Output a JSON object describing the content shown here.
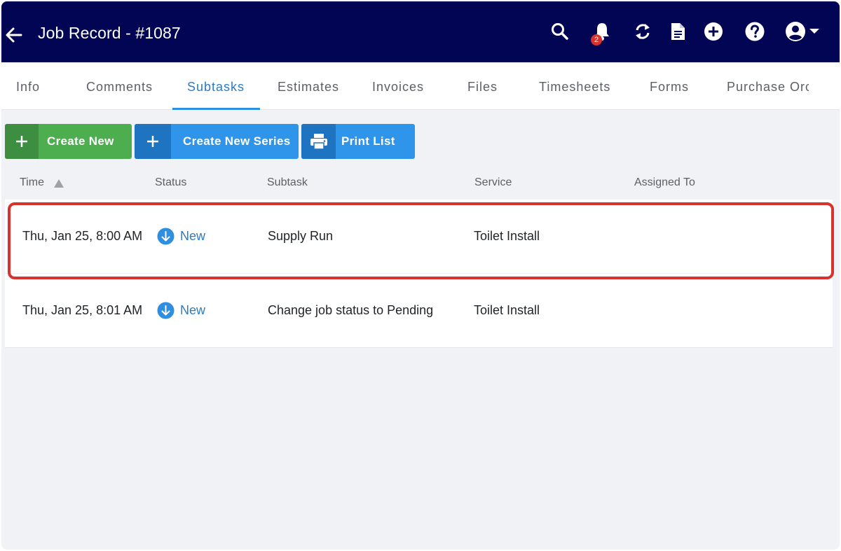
{
  "header": {
    "title": "Job Record - #1087",
    "notification_count": "2",
    "bg_color": "#020553",
    "icons": [
      "back-arrow-icon",
      "search-icon",
      "bell-icon",
      "refresh-icon",
      "document-icon",
      "add-circle-icon",
      "help-icon",
      "account-icon",
      "chevron-down-icon"
    ]
  },
  "tabs": [
    {
      "label": "Info"
    },
    {
      "label": "Comments"
    },
    {
      "label": "Subtasks",
      "active": true
    },
    {
      "label": "Estimates"
    },
    {
      "label": "Invoices"
    },
    {
      "label": "Files"
    },
    {
      "label": "Timesheets"
    },
    {
      "label": "Forms"
    },
    {
      "label": "Purchase Orc"
    }
  ],
  "actions": {
    "create_new": "Create New",
    "create_new_series": "Create New Series",
    "print_list": "Print List"
  },
  "table": {
    "columns": [
      "Time",
      "Status",
      "Subtask",
      "Service",
      "Assigned To"
    ],
    "sort": {
      "column": "Time",
      "direction": "ascending"
    },
    "rows": [
      {
        "time": "Thu, Jan 25, 8:00 AM",
        "status": "New",
        "subtask": "Supply Run",
        "service": "Toilet Install",
        "assigned_to": "",
        "highlighted": true
      },
      {
        "time": "Thu, Jan 25, 8:01 AM",
        "status": "New",
        "subtask": "Change job status to Pending",
        "service": "Toilet Install",
        "assigned_to": ""
      }
    ]
  },
  "colors": {
    "accent": "#2e8ee0",
    "create_new_green": "#4cae4f",
    "series_blue": "#2e95ea",
    "highlight_red": "#d9312b"
  }
}
